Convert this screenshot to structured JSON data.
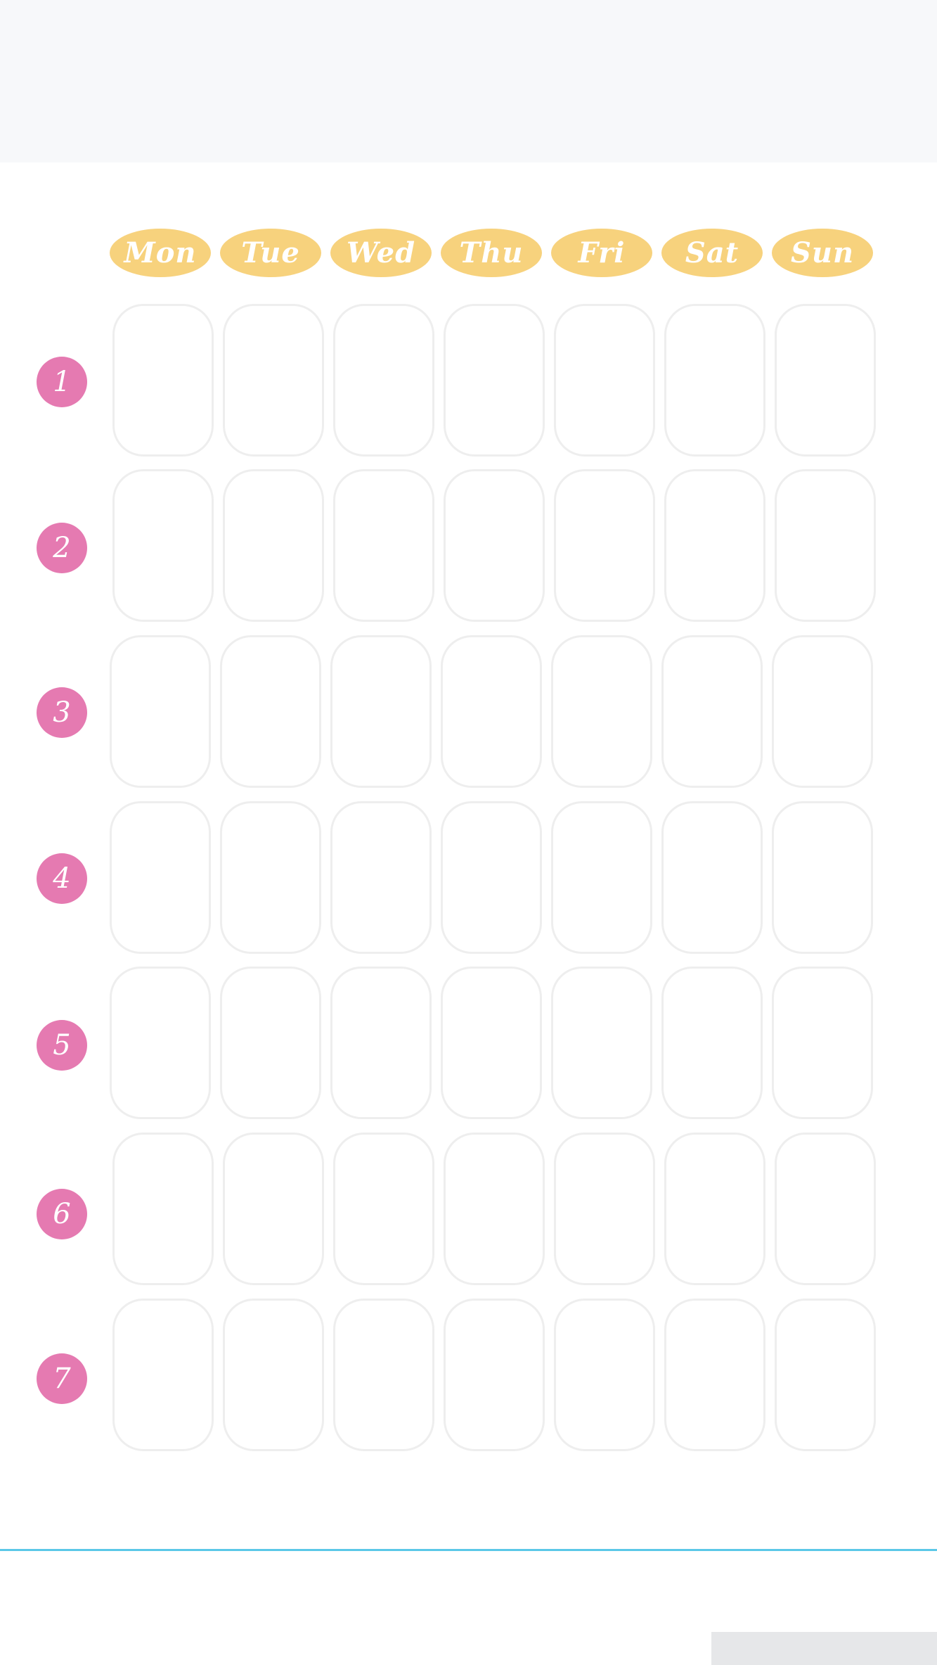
{
  "colors": {
    "header_band": "#f7f8fa",
    "day_pill": "#f7d27d",
    "week_badge": "#e57ab1",
    "cell_border": "#eeeeee",
    "divider": "#5bc8e8",
    "footer_block": "#e6e7e9"
  },
  "planner": {
    "days": [
      {
        "label": "Mon"
      },
      {
        "label": "Tue"
      },
      {
        "label": "Wed"
      },
      {
        "label": "Thu"
      },
      {
        "label": "Fri"
      },
      {
        "label": "Sat"
      },
      {
        "label": "Sun"
      }
    ],
    "weeks": [
      {
        "label": "1"
      },
      {
        "label": "2"
      },
      {
        "label": "3"
      },
      {
        "label": "4"
      },
      {
        "label": "5"
      },
      {
        "label": "6"
      },
      {
        "label": "7"
      }
    ]
  }
}
